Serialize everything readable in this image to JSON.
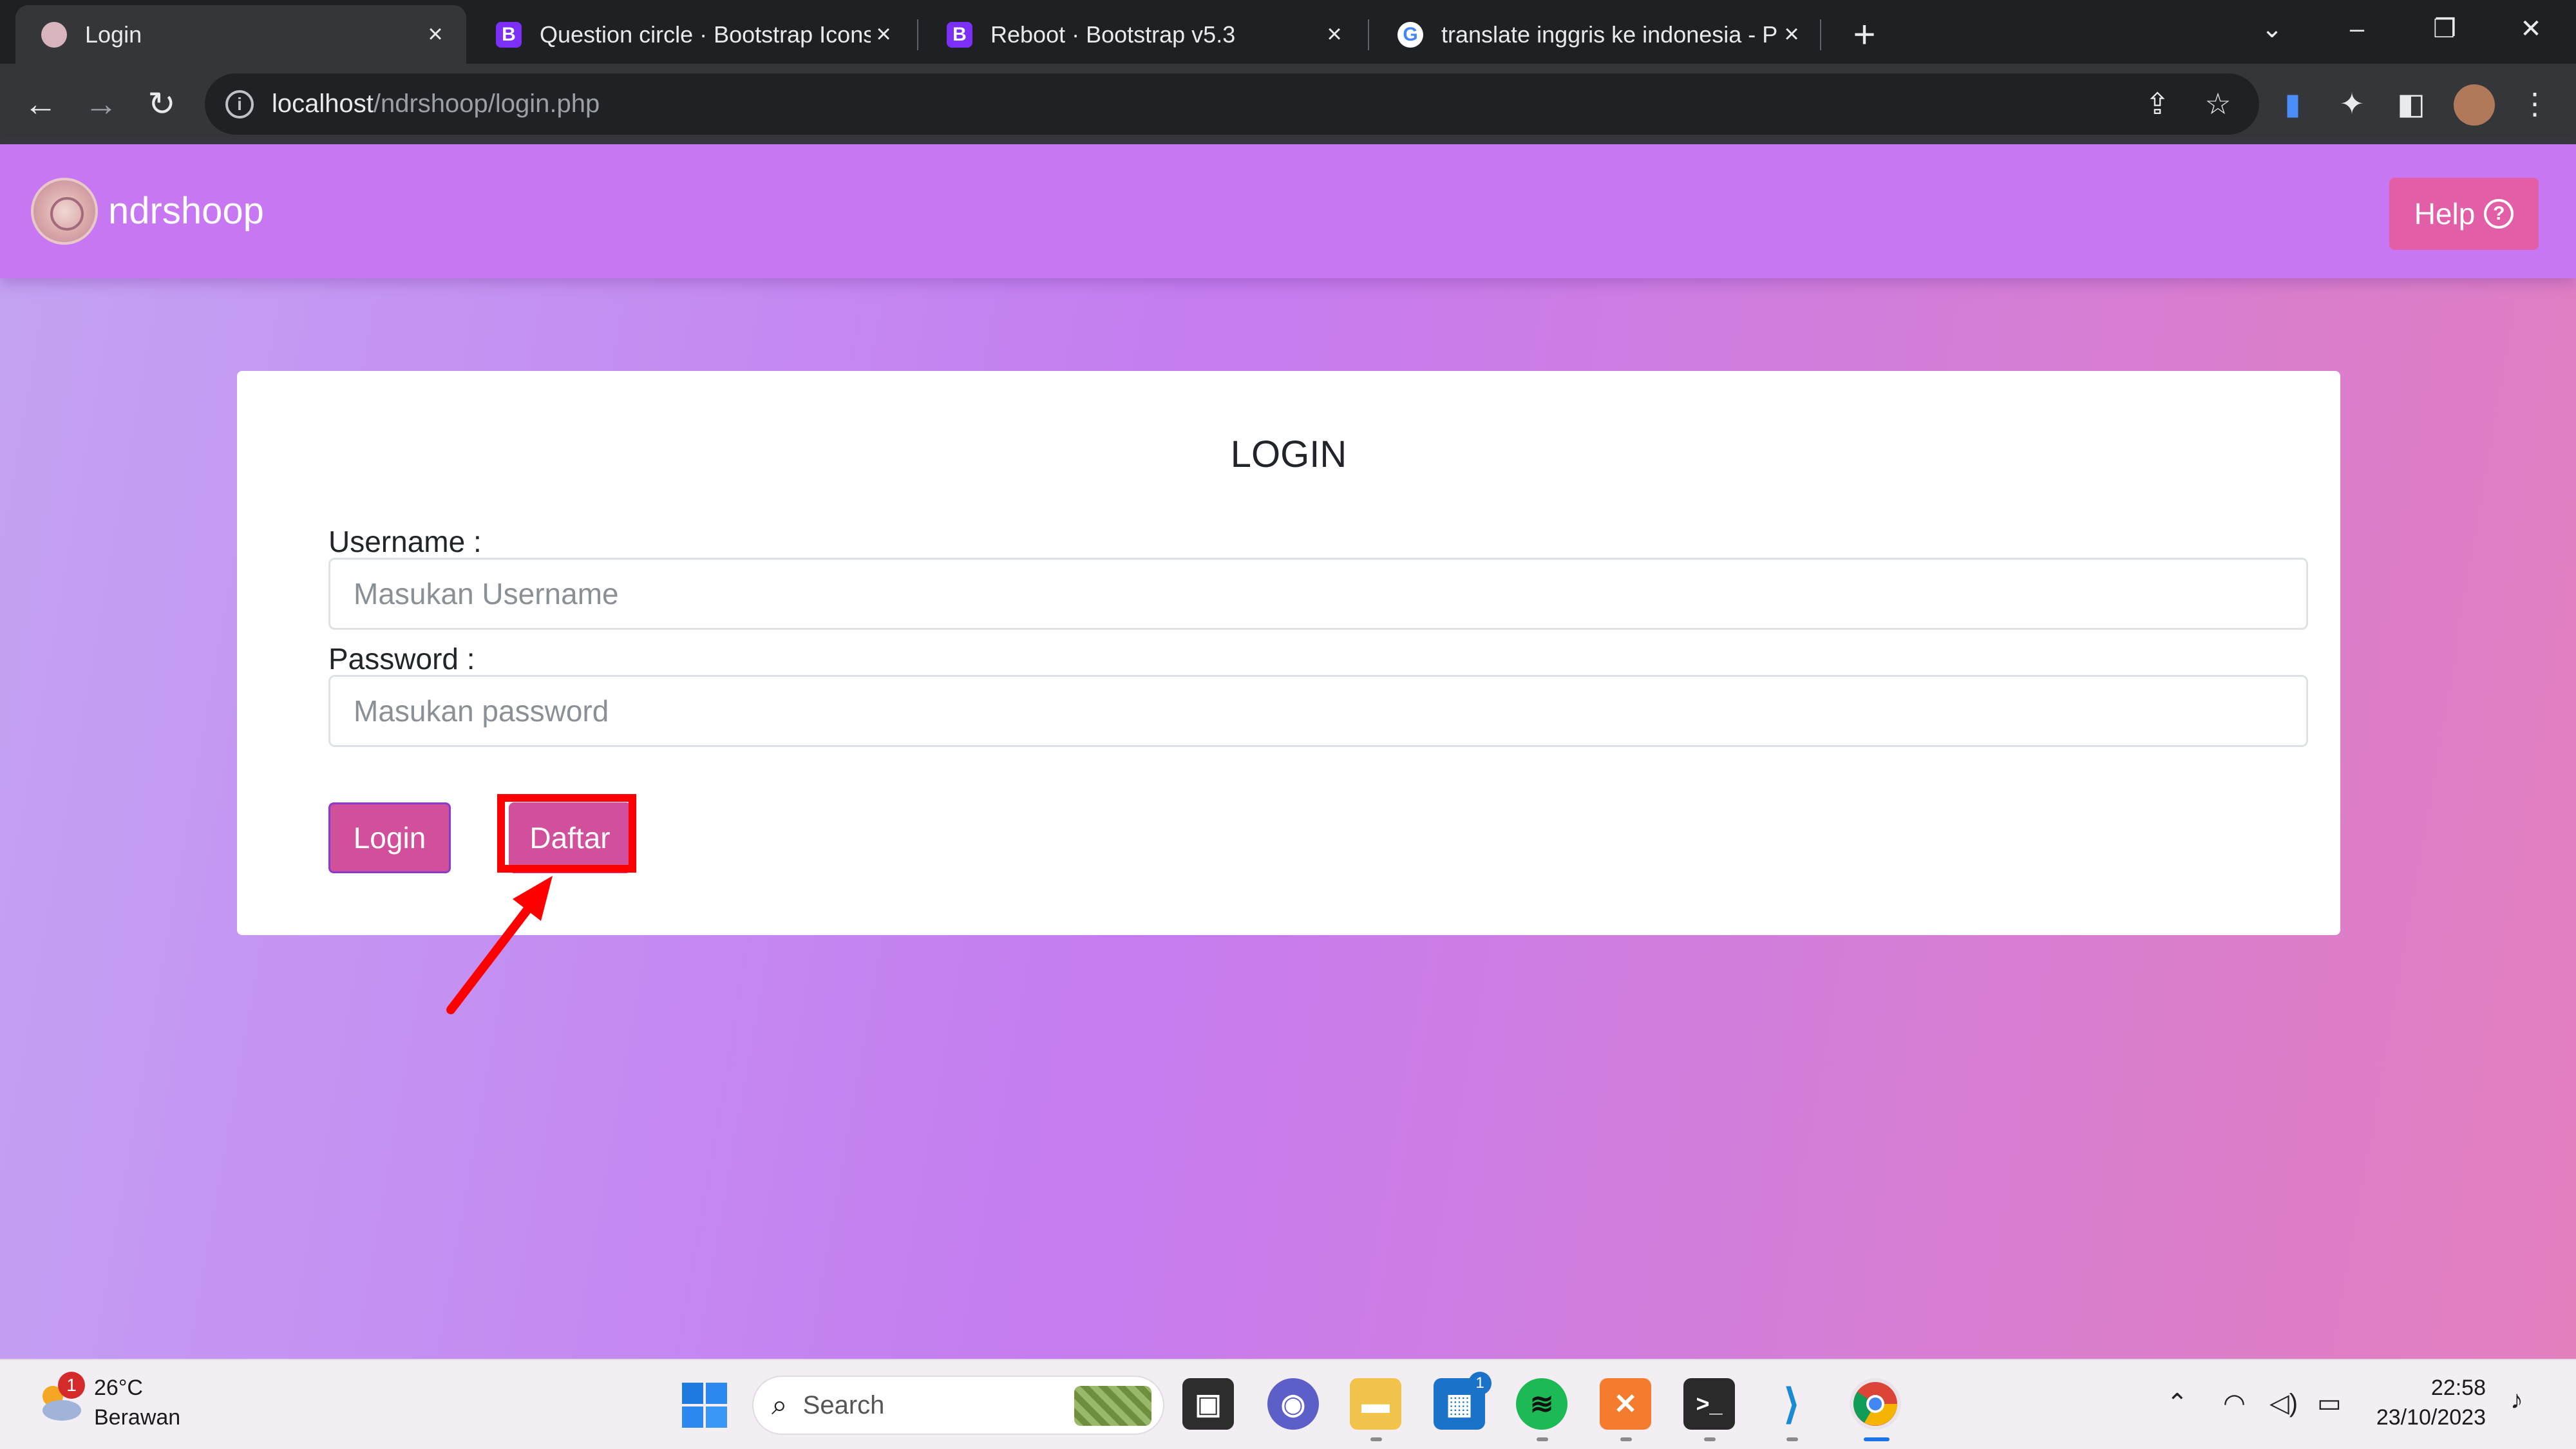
{
  "browser": {
    "tabs": [
      {
        "title": "Login",
        "favicon": "site-logo-icon"
      },
      {
        "title": "Question circle · Bootstrap Icons",
        "favicon": "bootstrap-icon"
      },
      {
        "title": "Reboot · Bootstrap v5.3",
        "favicon": "bootstrap-icon"
      },
      {
        "title": "translate inggris ke indonesia - P",
        "favicon": "google-icon"
      }
    ],
    "address": {
      "host": "localhost",
      "path": "/ndrshoop/login.php"
    }
  },
  "navbar": {
    "brand": "ndrshoop",
    "help_label": "Help"
  },
  "login": {
    "title": "LOGIN",
    "username_label": "Username :",
    "username_placeholder": "Masukan Username",
    "password_label": "Password :",
    "password_placeholder": "Masukan password",
    "login_button": "Login",
    "register_button": "Daftar"
  },
  "annotation": {
    "highlight_target": "Daftar",
    "color": "#ff0000"
  },
  "taskbar": {
    "weather": {
      "temp": "26°C",
      "desc": "Berawan",
      "badge": "1"
    },
    "search_label": "Search",
    "store_badge": "1",
    "time": "22:58",
    "date": "23/10/2023"
  },
  "colors": {
    "navbar": "#c877f2",
    "button": "#d14f9b",
    "help_button": "#e25fa8"
  }
}
